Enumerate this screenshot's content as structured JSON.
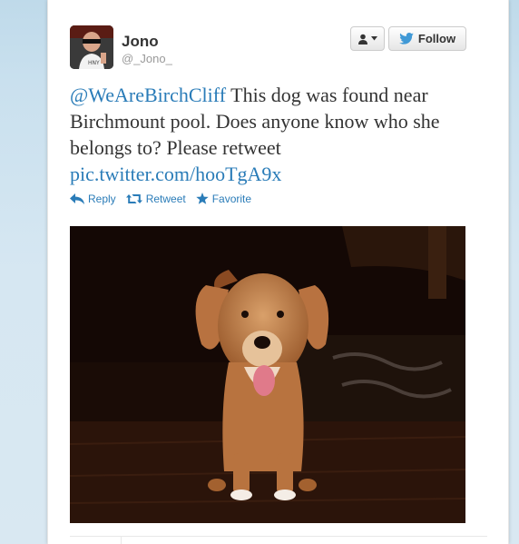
{
  "user": {
    "name": "Jono",
    "handle": "@_Jono_"
  },
  "buttons": {
    "user_menu_icon": "person-dropdown-icon",
    "follow_label": "Follow",
    "follow_icon": "twitter-bird-icon"
  },
  "tweet": {
    "mention": "@WeAreBirchCliff",
    "body": " This dog was found near Birchmount pool. Does anyone know who she belongs to? Please retweet ",
    "link": "pic.twitter.com/hooTgA9x"
  },
  "actions": {
    "reply": "Reply",
    "retweet": "Retweet",
    "favorite": "Favorite"
  },
  "colors": {
    "link": "#2a7cb8",
    "twitter_blue": "#4099d6",
    "text": "#333333"
  }
}
